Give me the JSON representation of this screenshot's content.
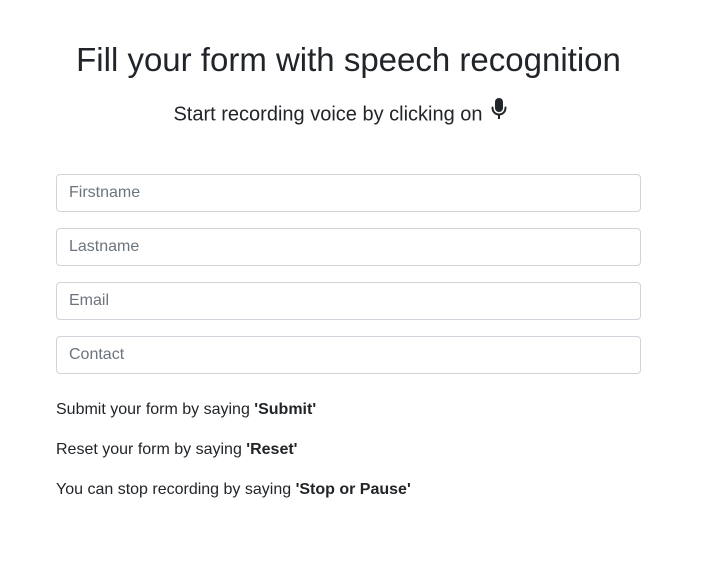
{
  "header": {
    "title": "Fill your form with speech recognition",
    "subtitle": "Start recording voice by clicking on"
  },
  "icons": {
    "mic": "microphone-icon"
  },
  "form": {
    "firstname": {
      "value": "",
      "placeholder": "Firstname"
    },
    "lastname": {
      "value": "",
      "placeholder": "Lastname"
    },
    "email": {
      "value": "",
      "placeholder": "Email"
    },
    "contact": {
      "value": "",
      "placeholder": "Contact"
    }
  },
  "hints": {
    "submit": {
      "text": "Submit your form by saying ",
      "command": "'Submit'"
    },
    "reset": {
      "text": "Reset your form by saying ",
      "command": "'Reset'"
    },
    "stop": {
      "text": "You can stop recording by saying ",
      "command": "'Stop or Pause'"
    }
  }
}
